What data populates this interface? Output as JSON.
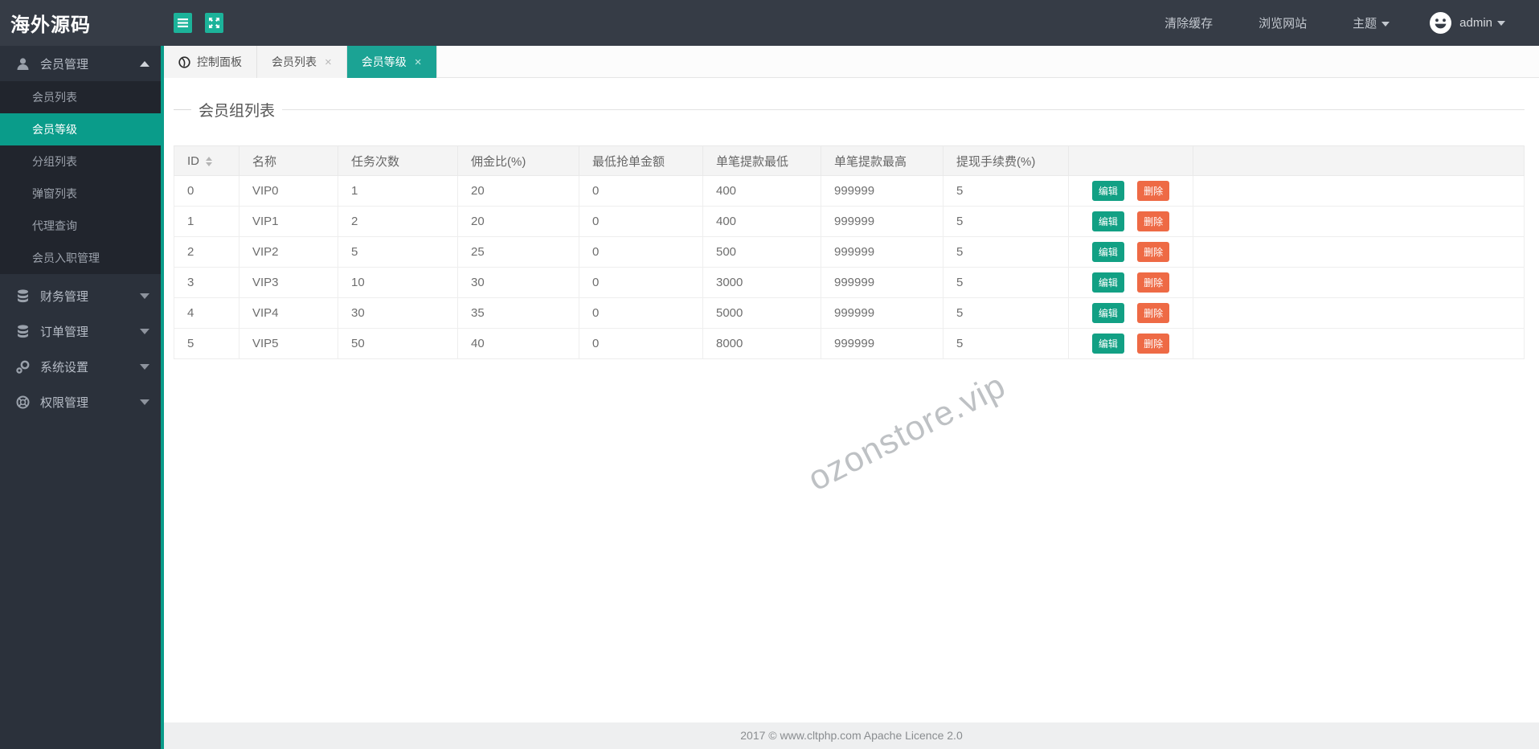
{
  "app": {
    "logo": "海外源码"
  },
  "header": {
    "actions": [
      {
        "label": "清除缓存"
      },
      {
        "label": "浏览网站"
      },
      {
        "label": "主题"
      }
    ],
    "user": {
      "name": "admin"
    }
  },
  "sidebar": {
    "sections": [
      {
        "label": "会员管理",
        "icon": "user-icon",
        "expanded": true,
        "children": [
          {
            "label": "会员列表",
            "active": false
          },
          {
            "label": "会员等级",
            "active": true
          },
          {
            "label": "分组列表",
            "active": false
          },
          {
            "label": "弹窗列表",
            "active": false
          },
          {
            "label": "代理查询",
            "active": false
          },
          {
            "label": "会员入职管理",
            "active": false
          }
        ]
      },
      {
        "label": "财务管理",
        "icon": "database-icon",
        "expanded": false
      },
      {
        "label": "订单管理",
        "icon": "database-icon",
        "expanded": false
      },
      {
        "label": "系统设置",
        "icon": "gears-icon",
        "expanded": false
      },
      {
        "label": "权限管理",
        "icon": "lifering-icon",
        "expanded": false
      }
    ]
  },
  "tabs": [
    {
      "label": "控制面板",
      "icon": "dashboard-icon",
      "closable": false,
      "active": false
    },
    {
      "label": "会员列表",
      "closable": true,
      "active": false
    },
    {
      "label": "会员等级",
      "closable": true,
      "active": true
    }
  ],
  "page": {
    "title": "会员组列表"
  },
  "table": {
    "columns": [
      "ID",
      "名称",
      "任务次数",
      "佣金比(%)",
      "最低抢单金额",
      "单笔提款最低",
      "单笔提款最高",
      "提现手续费(%)"
    ],
    "actions": {
      "edit": "编辑",
      "delete": "删除"
    },
    "rows": [
      [
        "0",
        "VIP0",
        "1",
        "20",
        "0",
        "400",
        "999999",
        "5"
      ],
      [
        "1",
        "VIP1",
        "2",
        "20",
        "0",
        "400",
        "999999",
        "5"
      ],
      [
        "2",
        "VIP2",
        "5",
        "25",
        "0",
        "500",
        "999999",
        "5"
      ],
      [
        "3",
        "VIP3",
        "10",
        "30",
        "0",
        "3000",
        "999999",
        "5"
      ],
      [
        "4",
        "VIP4",
        "30",
        "35",
        "0",
        "5000",
        "999999",
        "5"
      ],
      [
        "5",
        "VIP5",
        "50",
        "40",
        "0",
        "8000",
        "999999",
        "5"
      ]
    ]
  },
  "watermark": {
    "text": "ozonstore.vip"
  },
  "footer": {
    "text": "2017 ©  www.cltphp.com  Apache Licence 2.0"
  },
  "ui": {
    "close_glyph": "×"
  },
  "colors": {
    "accent_teal": "#1ba394",
    "sidebar_active_teal": "#0a9c8a",
    "header_button_teal": "#1cb39a",
    "edit_button": "#12a084",
    "delete_button": "#ee6a45",
    "header_bg": "#363c46",
    "sidebar_bg": "#2b313b",
    "submenu_bg": "#21252d"
  }
}
